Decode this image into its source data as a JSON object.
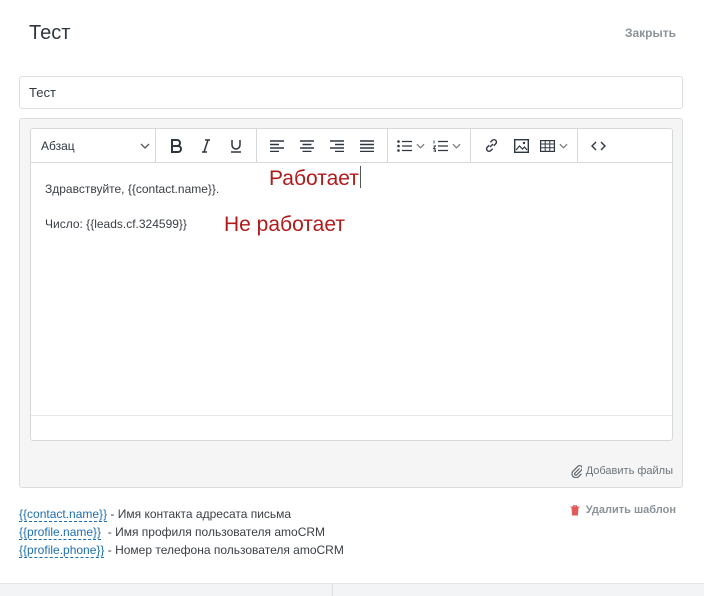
{
  "header": {
    "title": "Тест",
    "close_label": "Закрыть"
  },
  "template_name": {
    "value": "Тест"
  },
  "toolbar": {
    "format_label": "Абзац",
    "icons": [
      "bold-icon",
      "italic-icon",
      "underline-icon",
      "align-left-icon",
      "align-center-icon",
      "align-right-icon",
      "align-justify-icon",
      "bulleted-list-icon",
      "numbered-list-icon",
      "link-icon",
      "image-icon",
      "table-icon",
      "source-code-icon"
    ]
  },
  "editor": {
    "line1": "Здравствуйте, {{contact.name}}.",
    "line2": "Число: {{leads.cf.324599}}",
    "note_works": "Работает",
    "note_not_works": "Не работает"
  },
  "attach_label": "Добавить файлы",
  "delete_label": "Удалить шаблон",
  "placeholders": [
    {
      "tag": "{{contact.name}}",
      "desc": " - Имя контакта адресата письма"
    },
    {
      "tag": "{{profile.name}}",
      "desc": "  - Имя профиля пользователя amoCRM"
    },
    {
      "tag": "{{profile.phone}}",
      "desc": " - Номер телефона пользователя amoCRM"
    }
  ],
  "colors": {
    "annotation": "#b01a1a",
    "link": "#1f6fb0",
    "muted": "#8a9399",
    "delete_icon": "#e05a5a"
  }
}
